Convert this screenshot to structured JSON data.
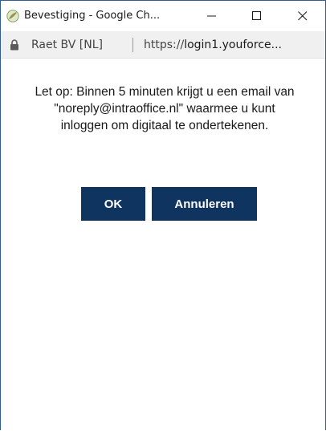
{
  "window": {
    "title": "Bevestiging - Google Ch...",
    "icons": {
      "app": "chrome-leaf-icon",
      "minimize": "minimize-icon",
      "maximize": "maximize-icon",
      "close": "close-icon"
    }
  },
  "addressbar": {
    "lock_icon": "lock-icon",
    "site_name": "Raet BV [NL]",
    "url_prefix": "https://",
    "url_domain": "login1.youforce..."
  },
  "dialog": {
    "message_lines": [
      "Let op: Binnen 5 minuten krijgt u een email van",
      "\"noreply@intraoffice.nl\" waarmee u kunt",
      "inloggen om digitaal te ondertekenen."
    ],
    "ok_label": "OK",
    "cancel_label": "Annuleren"
  },
  "colors": {
    "button_bg": "#0f3460",
    "button_text": "#ffffff",
    "window_border": "#2f5f9b",
    "addressbar_bg": "#f0f0f0"
  }
}
